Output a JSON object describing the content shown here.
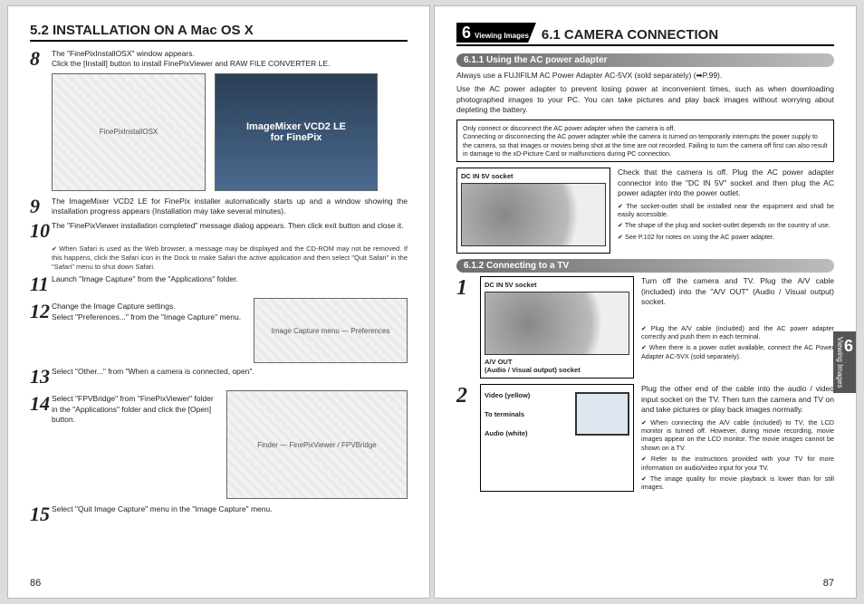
{
  "left": {
    "heading": "5.2 INSTALLATION ON A Mac OS X",
    "step8_num": "8",
    "step8": "The \"FinePixInstallOSX\" window appears.\nClick the [Install] button to install FinePixViewer and RAW FILE CONVERTER LE.",
    "fig8a_caption": "FinePixInstallOSX",
    "fig8b_caption": "ImageMixer VCD2 LE\nfor FinePix",
    "step9_num": "9",
    "step9": "The ImageMixer VCD2 LE for FinePix installer automatically starts up and a window showing the installation progress appears (Installation may take several minutes).",
    "step10_num": "10",
    "step10": "The \"FinePixViewer installation completed\" message dialog appears. Then click exit button and close it.",
    "note10": "When Safari is used as the Web browser, a message may be displayed and the CD-ROM may not be removed. If this happens, click the Safari icon in the Dock to make Safari the active application and then select \"Quit Safari\" in the \"Safari\" menu to shut down Safari.",
    "step11_num": "11",
    "step11": "Launch \"Image Capture\" from the \"Applications\" folder.",
    "step12_num": "12",
    "step12": "Change the Image Capture settings.\nSelect \"Preferences...\" from the \"Image Capture\" menu.",
    "fig12_caption": "Image Capture menu — Preferences",
    "step13_num": "13",
    "step13": "Select \"Other...\" from \"When a camera is connected, open\".",
    "step14_num": "14",
    "step14": "Select \"FPVBridge\" from \"FinePixViewer\" folder in the \"Applications\" folder and click the [Open] button.",
    "fig14_caption": "Finder — FinePixViewer / FPVBridge",
    "step15_num": "15",
    "step15": "Select \"Quit Image Capture\" menu in the \"Image Capture\" menu.",
    "page_num": "86"
  },
  "right": {
    "chapter_num": "6",
    "chapter_txt": "Viewing Images",
    "heading": "6.1 CAMERA CONNECTION",
    "sub1": "6.1.1 Using the AC power adapter",
    "intro1a": "Always use a FUJIFILM AC Power Adapter AC-5VX (sold separately) (➡P.99).",
    "intro1b": "Use the AC power adapter to prevent losing power at inconvenient times, such as when downloading photographed images to your PC. You can take pictures and play back images without worrying about depleting the battery.",
    "callout1": "Only connect or disconnect the AC power adapter when the camera is off.\nConnecting or disconnecting the AC power adapter while the camera is turned on temporarily interrupts the power supply to the camera, so that images or movies being shot at the time are not recorded. Failing to turn the camera off first can also result in damage to the xD-Picture Card or malfunctions during PC connection.",
    "d1_label": "DC IN 5V socket",
    "d1_text": "Check that the camera is off. Plug the AC power adapter connector into the \"DC IN 5V\" socket and then plug the AC power adapter into the power outlet.",
    "d1_n1": "The socket-outlet shall be installed near the equipment and shall be easily accessible.",
    "d1_n2": "The shape of the plug and socket-outlet depends on the country of use.",
    "d1_n3": "See P.102 for notes on using the AC power adapter.",
    "sub2": "6.1.2 Connecting to a TV",
    "r1_num": "1",
    "r1_label1": "DC IN 5V socket",
    "r1_label2": "A/V OUT\n(Audio / Visual output) socket",
    "r1_text": "Turn off the camera and TV. Plug the A/V cable (included) into the \"A/V OUT\" (Audio / Visual output) socket.",
    "r1_n1": "Plug the A/V cable (included) and the AC power adapter correctly and push them in each terminal.",
    "r1_n2": "When there is a power outlet available, connect the AC Power Adapter AC-5VX (sold separately).",
    "r2_num": "2",
    "r2_label1": "Video (yellow)",
    "r2_label2": "To terminals",
    "r2_label3": "Audio (white)",
    "r2_text": "Plug the other end of the cable into the audio / video input socket on the TV. Then turn the camera and TV on and take pictures or play back images normally.",
    "r2_n1": "When connecting the A/V cable (included) to TV, the LCD monitor is turned off. However, during movie recording, movie images appear on the LCD monitor. The movie images cannot be shown on a TV.",
    "r2_n2": "Refer to the instructions provided with your TV for more information on audio/video input for your TV.",
    "r2_n3": "The image quality for movie playback is lower than for still images.",
    "side_num": "6",
    "side_txt": "Viewing Images",
    "page_num": "87"
  }
}
